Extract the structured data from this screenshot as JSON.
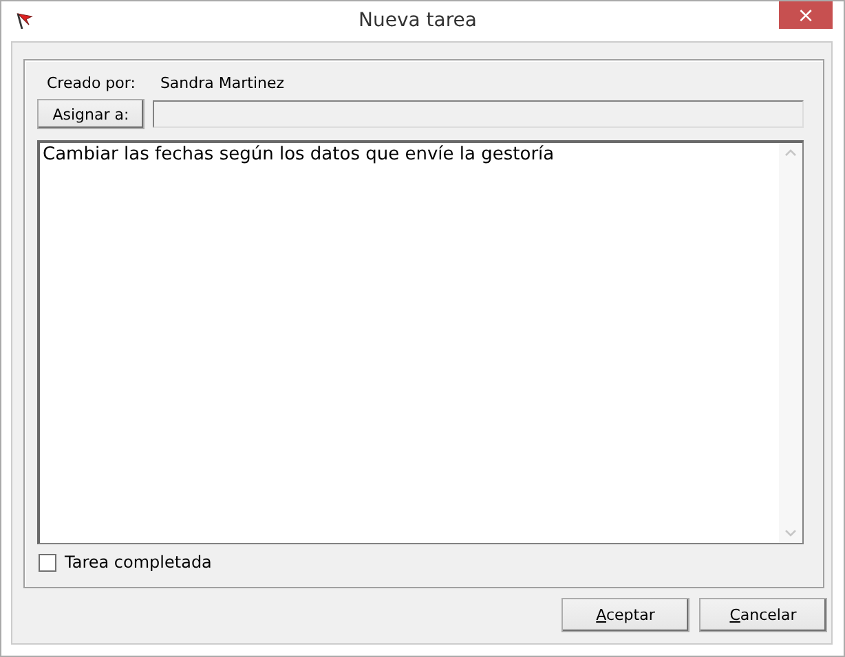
{
  "window": {
    "title": "Nueva tarea",
    "close": "×"
  },
  "created_by": {
    "label": "Creado por:",
    "value": "Sandra Martinez"
  },
  "assign": {
    "button": "Asignar a:"
  },
  "description": {
    "value": "Cambiar las fechas según los datos que envíe la gestoría"
  },
  "completed": {
    "label": "Tarea completada",
    "checked": false
  },
  "buttons": [
    {
      "label": "Aceptar",
      "access_key": true
    },
    {
      "label": "Cancelar",
      "access_key": true
    }
  ]
}
